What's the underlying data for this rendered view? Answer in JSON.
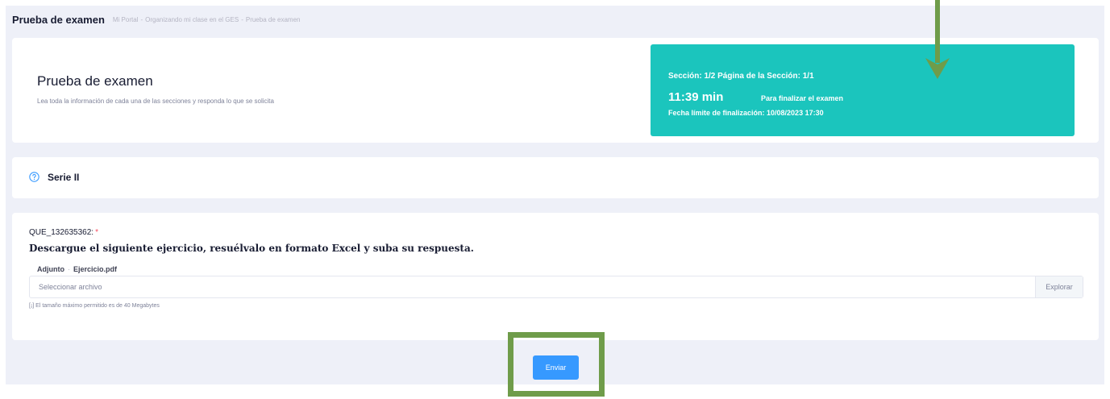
{
  "header": {
    "page_title": "Prueba de examen",
    "breadcrumbs": [
      "Mi Portal",
      "Organizando mi clase en el GES",
      "Prueba de examen"
    ]
  },
  "exam": {
    "title": "Prueba de examen",
    "description": "Lea toda la información de cada una de las secciones y responda lo que se solicita",
    "section_info": "Sección: 1/2 Página de la Sección: 1/1",
    "time_remaining": "11:39 min",
    "time_label": "Para finalizar el examen",
    "deadline": "Fecha límite de finalización: 10/08/2023 17:30"
  },
  "section": {
    "title": "Serie II"
  },
  "question": {
    "code": "QUE_132635362:",
    "required_mark": "*",
    "text": "Descargue el siguiente ejercicio, resuélvalo en formato Excel y suba su respuesta.",
    "attachment_label": "Adjunto",
    "attachment_file": "Ejercicio.pdf",
    "file_placeholder": "Seleccionar archivo",
    "browse_label": "Explorar",
    "help_text": "[¡] El tamaño máximo permitido es de 40 Megabytes"
  },
  "actions": {
    "submit_label": "Enviar"
  },
  "colors": {
    "info_box": "#1bc5bd",
    "primary": "#3699ff",
    "annotation": "#6f9c4a"
  }
}
